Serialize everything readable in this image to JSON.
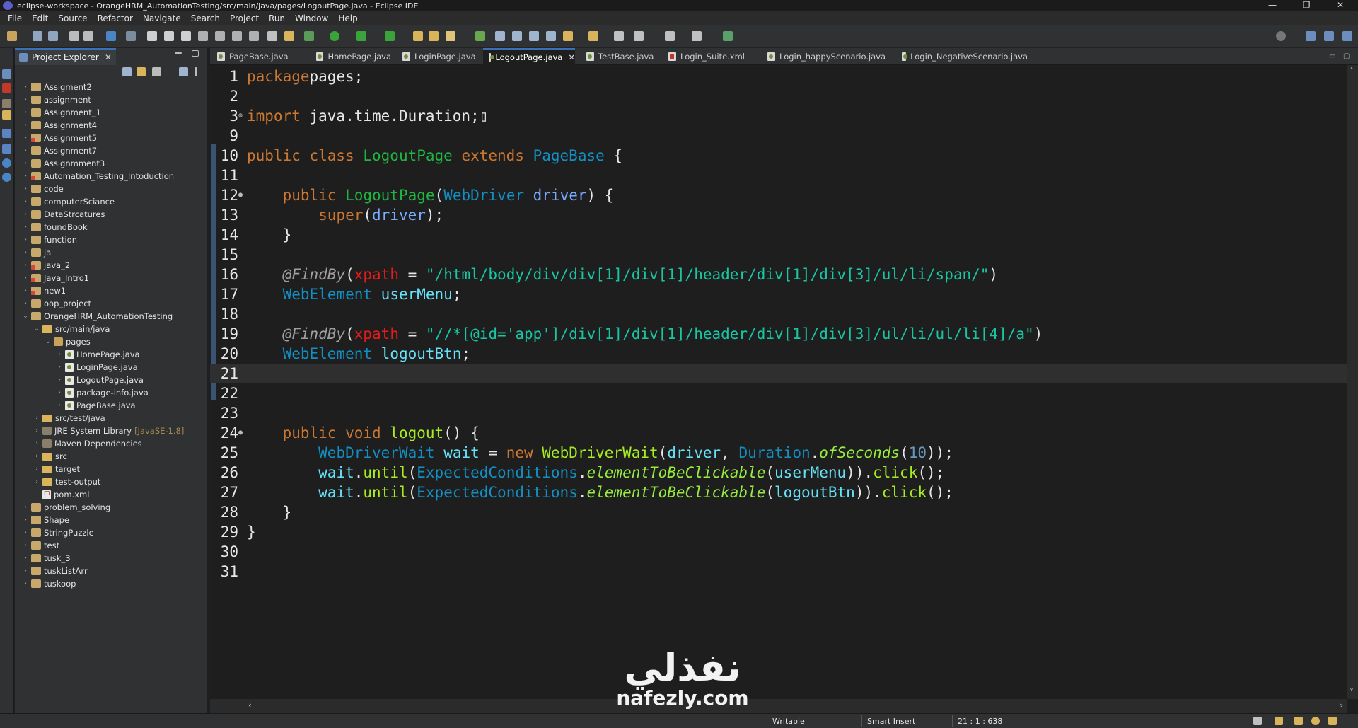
{
  "window": {
    "title": "eclipse-workspace - OrangeHRM_AutomationTesting/src/main/java/pages/LogoutPage.java - Eclipse IDE",
    "minimize": "—",
    "maximize": "❐",
    "close": "✕"
  },
  "menu": [
    "File",
    "Edit",
    "Source",
    "Refactor",
    "Navigate",
    "Search",
    "Project",
    "Run",
    "Window",
    "Help"
  ],
  "explorer": {
    "title": "Project Explorer",
    "close": "✕"
  },
  "tree": [
    {
      "label": "Assigment2",
      "type": "project",
      "depth": 0,
      "arrow": "›",
      "error": false
    },
    {
      "label": "assignment",
      "type": "project",
      "depth": 0,
      "arrow": "›",
      "error": false
    },
    {
      "label": "Assignment_1",
      "type": "project",
      "depth": 0,
      "arrow": "›",
      "error": false
    },
    {
      "label": "Assignment4",
      "type": "project",
      "depth": 0,
      "arrow": "›",
      "error": false
    },
    {
      "label": "Assignment5",
      "type": "project",
      "depth": 0,
      "arrow": "›",
      "error": true
    },
    {
      "label": "Assignment7",
      "type": "project",
      "depth": 0,
      "arrow": "›",
      "error": false
    },
    {
      "label": "Assignmment3",
      "type": "project",
      "depth": 0,
      "arrow": "›",
      "error": false
    },
    {
      "label": "Automation_Testing_Intoduction",
      "type": "project",
      "depth": 0,
      "arrow": "›",
      "error": true
    },
    {
      "label": "code",
      "type": "project",
      "depth": 0,
      "arrow": "›",
      "error": false
    },
    {
      "label": "computerSciance",
      "type": "project",
      "depth": 0,
      "arrow": "›",
      "error": false
    },
    {
      "label": "DataStrcatures",
      "type": "project",
      "depth": 0,
      "arrow": "›",
      "error": false
    },
    {
      "label": "foundBook",
      "type": "project",
      "depth": 0,
      "arrow": "›",
      "error": false
    },
    {
      "label": "function",
      "type": "project",
      "depth": 0,
      "arrow": "›",
      "error": false
    },
    {
      "label": "ja",
      "type": "project",
      "depth": 0,
      "arrow": "›",
      "error": false
    },
    {
      "label": "java_2",
      "type": "project",
      "depth": 0,
      "arrow": "›",
      "error": true
    },
    {
      "label": "Java_Intro1",
      "type": "project",
      "depth": 0,
      "arrow": "›",
      "error": true
    },
    {
      "label": "new1",
      "type": "project",
      "depth": 0,
      "arrow": "›",
      "error": true
    },
    {
      "label": "oop_project",
      "type": "project",
      "depth": 0,
      "arrow": "›",
      "error": false
    },
    {
      "label": "OrangeHRM_AutomationTesting",
      "type": "project",
      "depth": 0,
      "arrow": "⌄",
      "error": false
    },
    {
      "label": "src/main/java",
      "type": "folder",
      "depth": 1,
      "arrow": "⌄",
      "error": false
    },
    {
      "label": "pages",
      "type": "package",
      "depth": 2,
      "arrow": "⌄",
      "error": false
    },
    {
      "label": "HomePage.java",
      "type": "java",
      "depth": 3,
      "arrow": "›",
      "error": false
    },
    {
      "label": "LoginPage.java",
      "type": "java",
      "depth": 3,
      "arrow": "›",
      "error": false
    },
    {
      "label": "LogoutPage.java",
      "type": "java",
      "depth": 3,
      "arrow": "›",
      "error": false
    },
    {
      "label": "package-info.java",
      "type": "java",
      "depth": 3,
      "arrow": "›",
      "error": false
    },
    {
      "label": "PageBase.java",
      "type": "java",
      "depth": 3,
      "arrow": "›",
      "error": false
    },
    {
      "label": "src/test/java",
      "type": "folder",
      "depth": 1,
      "arrow": "›",
      "error": false
    },
    {
      "label": "JRE System Library",
      "type": "library",
      "depth": 1,
      "arrow": "›",
      "error": false,
      "decoration": "[JavaSE-1.8]"
    },
    {
      "label": "Maven Dependencies",
      "type": "library",
      "depth": 1,
      "arrow": "›",
      "error": false
    },
    {
      "label": "src",
      "type": "folder",
      "depth": 1,
      "arrow": "›",
      "error": false
    },
    {
      "label": "target",
      "type": "folder",
      "depth": 1,
      "arrow": "›",
      "error": false
    },
    {
      "label": "test-output",
      "type": "folder",
      "depth": 1,
      "arrow": "›",
      "error": false
    },
    {
      "label": "pom.xml",
      "type": "xml",
      "depth": 1,
      "arrow": "",
      "error": false
    },
    {
      "label": "problem_solving",
      "type": "project",
      "depth": 0,
      "arrow": "›",
      "error": false
    },
    {
      "label": "Shape",
      "type": "project",
      "depth": 0,
      "arrow": "›",
      "error": false
    },
    {
      "label": "StringPuzzle",
      "type": "project",
      "depth": 0,
      "arrow": "›",
      "error": false
    },
    {
      "label": "test",
      "type": "project",
      "depth": 0,
      "arrow": "›",
      "error": false
    },
    {
      "label": "tusk_3",
      "type": "project",
      "depth": 0,
      "arrow": "›",
      "error": false
    },
    {
      "label": "tuskListArr",
      "type": "project",
      "depth": 0,
      "arrow": "›",
      "error": false
    },
    {
      "label": "tuskoop",
      "type": "project",
      "depth": 0,
      "arrow": "›",
      "error": false
    }
  ],
  "tabs": [
    {
      "label": "PageBase.java",
      "kind": "java",
      "active": false
    },
    {
      "label": "HomePage.java",
      "kind": "java",
      "active": false
    },
    {
      "label": "LoginPage.java",
      "kind": "java",
      "active": false
    },
    {
      "label": "LogoutPage.java",
      "kind": "java",
      "active": true
    },
    {
      "label": "TestBase.java",
      "kind": "java",
      "active": false
    },
    {
      "label": "Login_Suite.xml",
      "kind": "xml",
      "active": false
    },
    {
      "label": "Login_happyScenario.java",
      "kind": "java",
      "active": false
    },
    {
      "label": "Login_NegativeScenario.java",
      "kind": "java",
      "active": false
    }
  ],
  "tab_close": "✕",
  "code": {
    "current_line": "21",
    "lines": [
      {
        "n": "1",
        "fold": "",
        "tokens": [
          [
            "k",
            "package"
          ],
          [
            "",
            "pages;"
          ]
        ]
      },
      {
        "n": "2",
        "fold": "",
        "tokens": []
      },
      {
        "n": "3",
        "fold": "⊕",
        "tokens": [
          [
            "k",
            "import"
          ],
          [
            "",
            " java.time.Duration;"
          ],
          [
            "",
            "▯"
          ]
        ]
      },
      {
        "n": "9",
        "fold": "",
        "tokens": []
      },
      {
        "n": "10",
        "fold": "",
        "tokens": [
          [
            "k",
            "public class "
          ],
          [
            "c",
            "LogoutPage"
          ],
          [
            "k",
            " extends "
          ],
          [
            "t",
            "PageBase"
          ],
          [
            "",
            " {"
          ]
        ]
      },
      {
        "n": "11",
        "fold": "",
        "tokens": []
      },
      {
        "n": "12",
        "fold": "●",
        "tokens": [
          [
            "",
            "    "
          ],
          [
            "k",
            "public "
          ],
          [
            "c",
            "LogoutPage"
          ],
          [
            "",
            "("
          ],
          [
            "t",
            "WebDriver"
          ],
          [
            "",
            " "
          ],
          [
            "f",
            "driver"
          ],
          [
            "",
            ") {"
          ]
        ]
      },
      {
        "n": "13",
        "fold": "",
        "tokens": [
          [
            "",
            "        "
          ],
          [
            "k",
            "super"
          ],
          [
            "",
            "("
          ],
          [
            "f",
            "driver"
          ],
          [
            "",
            ");"
          ]
        ]
      },
      {
        "n": "14",
        "fold": "",
        "tokens": [
          [
            "",
            "    }"
          ]
        ]
      },
      {
        "n": "15",
        "fold": "",
        "tokens": []
      },
      {
        "n": "16",
        "fold": "",
        "tokens": [
          [
            "",
            "    "
          ],
          [
            "a",
            "@FindBy"
          ],
          [
            "",
            "("
          ],
          [
            "ap",
            "xpath"
          ],
          [
            "",
            " = "
          ],
          [
            "s",
            "\"/html/body/div/div[1]/div[1]/header/div[1]/div[3]/ul/li/span/\""
          ],
          [
            "",
            ")"
          ]
        ]
      },
      {
        "n": "17",
        "fold": "",
        "tokens": [
          [
            "",
            "    "
          ],
          [
            "t",
            "WebElement"
          ],
          [
            "",
            " "
          ],
          [
            "v",
            "userMenu"
          ],
          [
            "",
            ";"
          ]
        ]
      },
      {
        "n": "18",
        "fold": "",
        "tokens": []
      },
      {
        "n": "19",
        "fold": "",
        "tokens": [
          [
            "",
            "    "
          ],
          [
            "a",
            "@FindBy"
          ],
          [
            "",
            "("
          ],
          [
            "ap",
            "xpath"
          ],
          [
            "",
            " = "
          ],
          [
            "s",
            "\"//*[@id='app']/div[1]/div[1]/header/div[1]/div[3]/ul/li/ul/li[4]/a\""
          ],
          [
            "",
            ")"
          ]
        ]
      },
      {
        "n": "20",
        "fold": "",
        "tokens": [
          [
            "",
            "    "
          ],
          [
            "t",
            "WebElement"
          ],
          [
            "",
            " "
          ],
          [
            "v",
            "logoutBtn"
          ],
          [
            "",
            ";"
          ]
        ]
      },
      {
        "n": "21",
        "fold": "",
        "tokens": []
      },
      {
        "n": "22",
        "fold": "",
        "tokens": []
      },
      {
        "n": "23",
        "fold": "",
        "tokens": []
      },
      {
        "n": "24",
        "fold": "●",
        "tokens": [
          [
            "",
            "    "
          ],
          [
            "k",
            "public void "
          ],
          [
            "p",
            "logout"
          ],
          [
            "",
            "() {"
          ]
        ]
      },
      {
        "n": "25",
        "fold": "",
        "tokens": [
          [
            "",
            "        "
          ],
          [
            "t",
            "WebDriverWait"
          ],
          [
            "",
            " "
          ],
          [
            "v",
            "wait"
          ],
          [
            "",
            " = "
          ],
          [
            "k",
            "new "
          ],
          [
            "p",
            "WebDriverWait"
          ],
          [
            "",
            "("
          ],
          [
            "v",
            "driver"
          ],
          [
            "",
            ", "
          ],
          [
            "t",
            "Duration"
          ],
          [
            "",
            "."
          ],
          [
            "i",
            "ofSeconds"
          ],
          [
            "",
            "("
          ],
          [
            "n",
            "10"
          ],
          [
            "",
            "));"
          ]
        ]
      },
      {
        "n": "26",
        "fold": "",
        "tokens": [
          [
            "",
            "        "
          ],
          [
            "v",
            "wait"
          ],
          [
            "",
            "."
          ],
          [
            "m",
            "until"
          ],
          [
            "",
            "("
          ],
          [
            "t",
            "ExpectedConditions"
          ],
          [
            "",
            "."
          ],
          [
            "i",
            "elementToBeClickable"
          ],
          [
            "",
            "("
          ],
          [
            "v",
            "userMenu"
          ],
          [
            "",
            "))."
          ],
          [
            "m",
            "click"
          ],
          [
            "",
            "();"
          ]
        ]
      },
      {
        "n": "27",
        "fold": "",
        "tokens": [
          [
            "",
            "        "
          ],
          [
            "v",
            "wait"
          ],
          [
            "",
            "."
          ],
          [
            "m",
            "until"
          ],
          [
            "",
            "("
          ],
          [
            "t",
            "ExpectedConditions"
          ],
          [
            "",
            "."
          ],
          [
            "i",
            "elementToBeClickable"
          ],
          [
            "",
            "("
          ],
          [
            "v",
            "logoutBtn"
          ],
          [
            "",
            "))."
          ],
          [
            "m",
            "click"
          ],
          [
            "",
            "();"
          ]
        ]
      },
      {
        "n": "28",
        "fold": "",
        "tokens": [
          [
            "",
            "    }"
          ]
        ]
      },
      {
        "n": "29",
        "fold": "",
        "tokens": [
          [
            "",
            "}"
          ]
        ]
      },
      {
        "n": "30",
        "fold": "",
        "tokens": []
      },
      {
        "n": "31",
        "fold": "",
        "tokens": []
      }
    ]
  },
  "watermark": {
    "arabic": "نفذلي",
    "latin": "nafezly.com"
  },
  "status": {
    "writable": "Writable",
    "insert_mode": "Smart Insert",
    "position": "21 : 1 : 638"
  },
  "colors": {
    "keyword": "#cc7832",
    "type": "#1290c3",
    "class_name": "#1eb540",
    "string": "#17c6a3",
    "accent_tab": "#3b6fb6"
  }
}
